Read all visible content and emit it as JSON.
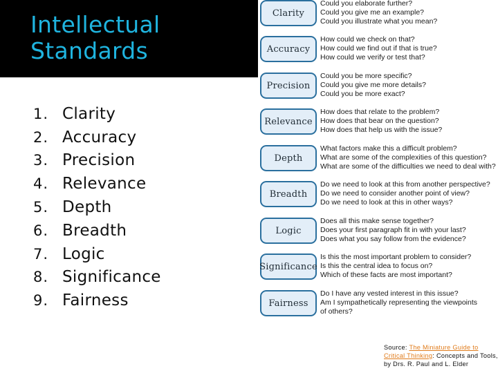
{
  "title": {
    "line1": "Intellectual",
    "line2": "Standards",
    "color": "#1fb4df"
  },
  "standards_list": [
    {
      "num": "1.",
      "label": "Clarity"
    },
    {
      "num": "2.",
      "label": "Accuracy"
    },
    {
      "num": "3.",
      "label": "Precision"
    },
    {
      "num": "4.",
      "label": "Relevance"
    },
    {
      "num": "5.",
      "label": "Depth"
    },
    {
      "num": "6.",
      "label": "Breadth"
    },
    {
      "num": "7.",
      "label": "Logic"
    },
    {
      "num": "8.",
      "label": "Significance"
    },
    {
      "num": "9.",
      "label": "Fairness"
    }
  ],
  "standards_chart": [
    {
      "name": "Clarity",
      "questions": [
        "Could you elaborate further?",
        "Could you give me an example?",
        "Could you illustrate what you mean?"
      ]
    },
    {
      "name": "Accuracy",
      "questions": [
        "How could we check on that?",
        "How could we find out if that is true?",
        "How could we verify or test that?"
      ]
    },
    {
      "name": "Precision",
      "questions": [
        "Could you be more specific?",
        "Could you give me more details?",
        "Could you be more exact?"
      ]
    },
    {
      "name": "Relevance",
      "questions": [
        "How does that relate to the problem?",
        "How does that bear on the question?",
        "How does that help us with the issue?"
      ]
    },
    {
      "name": "Depth",
      "questions": [
        "What factors make this a difficult problem?",
        "What are some of the complexities of this question?",
        "What are some of the difficulties we need to deal with?"
      ]
    },
    {
      "name": "Breadth",
      "questions": [
        "Do we need to look at this from another perspective?",
        "Do we need to consider another point of view?",
        "Do we need to look at this in other ways?"
      ]
    },
    {
      "name": "Logic",
      "questions": [
        "Does all this make sense together?",
        "Does your first paragraph fit in with your last?",
        "Does what you say follow from the evidence?"
      ]
    },
    {
      "name": "Significance",
      "questions": [
        "Is this the most important problem to consider?",
        "Is this the central idea to focus on?",
        "Which of these facts are most important?"
      ]
    },
    {
      "name": "Fairness",
      "questions": [
        "Do I have any vested interest in this issue?",
        "Am I sympathetically representing the viewpoints",
        "of others?"
      ]
    }
  ],
  "source": {
    "prefix": "Source: ",
    "link_text": "The Miniature Guide to Critical Thinking",
    "suffix": ": Concepts and Tools, by Drs. R. Paul and L. Elder",
    "link_color": "#e07b1a"
  }
}
